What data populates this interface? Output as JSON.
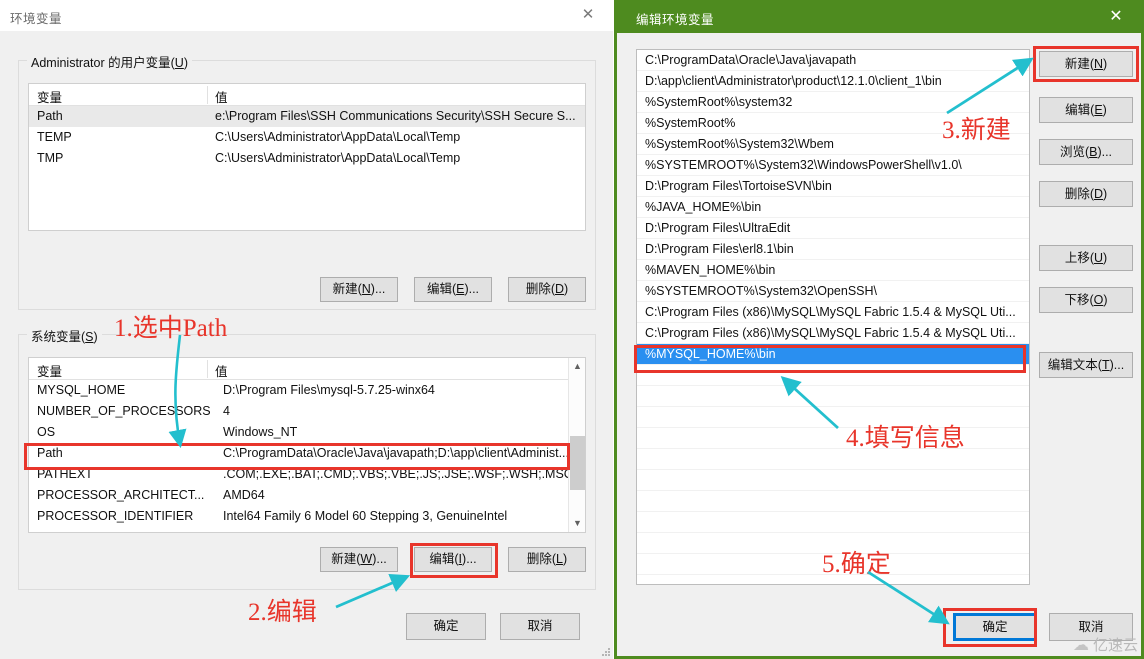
{
  "left_dialog": {
    "title": "环境变量",
    "close_icon": "close-icon",
    "user_group_label": "Administrator 的用户变量(U)",
    "user_table": {
      "headers": [
        "变量",
        "值"
      ],
      "rows": [
        {
          "name": "Path",
          "value": "e:\\Program Files\\SSH Communications Security\\SSH Secure S...",
          "selected": true
        },
        {
          "name": "TEMP",
          "value": "C:\\Users\\Administrator\\AppData\\Local\\Temp",
          "selected": false
        },
        {
          "name": "TMP",
          "value": "C:\\Users\\Administrator\\AppData\\Local\\Temp",
          "selected": false
        }
      ]
    },
    "user_buttons": [
      "新建(N)...",
      "编辑(E)...",
      "删除(D)"
    ],
    "system_group_label": "系统变量(S)",
    "system_table": {
      "headers": [
        "变量",
        "值"
      ],
      "rows": [
        {
          "name": "MYSQL_HOME",
          "value": "D:\\Program Files\\mysql-5.7.25-winx64",
          "highlighted": false
        },
        {
          "name": "NUMBER_OF_PROCESSORS",
          "value": "4",
          "highlighted": false
        },
        {
          "name": "OS",
          "value": "Windows_NT",
          "highlighted": false
        },
        {
          "name": "Path",
          "value": "C:\\ProgramData\\Oracle\\Java\\javapath;D:\\app\\client\\Administ...",
          "highlighted": true
        },
        {
          "name": "PATHEXT",
          "value": ".COM;.EXE;.BAT;.CMD;.VBS;.VBE;.JS;.JSE;.WSF;.WSH;.MSC",
          "highlighted": false
        },
        {
          "name": "PROCESSOR_ARCHITECT...",
          "value": "AMD64",
          "highlighted": false
        },
        {
          "name": "PROCESSOR_IDENTIFIER",
          "value": "Intel64 Family 6 Model 60 Stepping 3, GenuineIntel",
          "highlighted": false
        }
      ]
    },
    "system_buttons": [
      "新建(W)...",
      "编辑(I)...",
      "删除(L)"
    ],
    "ok_label": "确定",
    "cancel_label": "取消"
  },
  "right_dialog": {
    "title": "编辑环境变量",
    "close_icon": "close-icon",
    "path_entries": [
      "C:\\ProgramData\\Oracle\\Java\\javapath",
      "D:\\app\\client\\Administrator\\product\\12.1.0\\client_1\\bin",
      "%SystemRoot%\\system32",
      "%SystemRoot%",
      "%SystemRoot%\\System32\\Wbem",
      "%SYSTEMROOT%\\System32\\WindowsPowerShell\\v1.0\\",
      "D:\\Program Files\\TortoiseSVN\\bin",
      "%JAVA_HOME%\\bin",
      "D:\\Program Files\\UltraEdit",
      "D:\\Program Files\\erl8.1\\bin",
      "%MAVEN_HOME%\\bin",
      "%SYSTEMROOT%\\System32\\OpenSSH\\",
      "C:\\Program Files (x86)\\MySQL\\MySQL Fabric 1.5.4 & MySQL Uti...",
      "C:\\Program Files (x86)\\MySQL\\MySQL Fabric 1.5.4 & MySQL Uti...",
      "%MYSQL_HOME%\\bin"
    ],
    "selected_index": 14,
    "side_buttons": [
      "新建(N)",
      "编辑(E)",
      "浏览(B)...",
      "删除(D)",
      "上移(U)",
      "下移(O)",
      "编辑文本(T)..."
    ],
    "ok_label": "确定",
    "cancel_label": "取消"
  },
  "annotations": [
    {
      "id": "a1",
      "text": "1.选中Path"
    },
    {
      "id": "a2",
      "text": "2.编辑"
    },
    {
      "id": "a3",
      "text": "3.新建"
    },
    {
      "id": "a4",
      "text": "4.填写信息"
    },
    {
      "id": "a5",
      "text": "5.确定"
    }
  ],
  "watermark": {
    "text": "亿速云",
    "icon": "cloud-icon"
  },
  "colors": {
    "annotation_red": "#e8352b",
    "arrow_teal": "#23bfce",
    "title_green": "#4e8b1f",
    "selection_blue": "#2a8ff0",
    "focus_blue": "#0078d7"
  }
}
